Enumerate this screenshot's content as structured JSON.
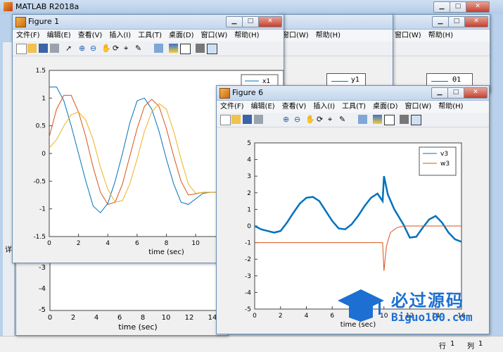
{
  "main_window": {
    "title": "MATLAB R2018a"
  },
  "statusbar": {
    "row_label": "行",
    "row_value": "1",
    "col_label": "列",
    "col_value": "1"
  },
  "left_panel": {
    "text": "详"
  },
  "menu": [
    "文件(F)",
    "编辑(E)",
    "查看(V)",
    "插入(I)",
    "工具(T)",
    "桌面(D)",
    "窗口(W)",
    "帮助(H)"
  ],
  "menu_back": [
    "窗口(W)",
    "帮助(H)"
  ],
  "figure1": {
    "title": "Figure 1",
    "xlabel": "time (sec)",
    "xticks": [
      "0",
      "2",
      "4",
      "6",
      "8",
      "10",
      "12",
      "14",
      "1"
    ],
    "yticks": [
      "1.5",
      "1",
      "0.5",
      "0",
      "-0.5",
      "-1",
      "-1.5"
    ],
    "legend": [
      "x1"
    ],
    "chart_data": {
      "type": "line",
      "xlim": [
        0,
        16
      ],
      "ylim": [
        -1.5,
        1.5
      ],
      "series": [
        {
          "name": "x1",
          "color": "#0072BD",
          "x": [
            0,
            0.5,
            1,
            1.5,
            2,
            2.5,
            3,
            3.5,
            4,
            4.5,
            5,
            5.5,
            6,
            6.5,
            7,
            7.5,
            8,
            8.5,
            9,
            9.5,
            10,
            10.5,
            11,
            12,
            14,
            16
          ],
          "y": [
            1.2,
            1.2,
            0.95,
            0.5,
            0.0,
            -0.5,
            -0.95,
            -1.07,
            -0.9,
            -0.5,
            0.0,
            0.55,
            0.95,
            1.0,
            0.8,
            0.4,
            -0.1,
            -0.55,
            -0.88,
            -0.92,
            -0.82,
            -0.72,
            -0.7,
            -0.7,
            -0.7,
            -0.7
          ]
        },
        {
          "name": "",
          "color": "#D95319",
          "x": [
            0,
            0.5,
            1,
            1.5,
            2,
            2.5,
            3,
            3.5,
            4,
            4.5,
            5,
            5.5,
            6,
            6.5,
            7,
            7.5,
            8,
            8.5,
            9,
            9.5,
            10,
            10.5,
            11,
            12,
            14,
            16
          ],
          "y": [
            0.3,
            0.8,
            1.05,
            1.05,
            0.75,
            0.3,
            -0.25,
            -0.7,
            -0.92,
            -0.88,
            -0.55,
            -0.05,
            0.45,
            0.85,
            0.98,
            0.85,
            0.45,
            -0.05,
            -0.5,
            -0.75,
            -0.73,
            -0.7,
            -0.7,
            -0.7,
            -0.7,
            -0.7
          ]
        },
        {
          "name": "",
          "color": "#EDB120",
          "x": [
            0,
            0.5,
            1,
            1.5,
            2,
            2.5,
            3,
            3.5,
            4,
            4.5,
            5,
            5.5,
            6,
            6.5,
            7,
            7.5,
            8,
            8.5,
            9,
            9.5,
            10,
            10.5,
            11,
            12,
            14,
            16
          ],
          "y": [
            0.1,
            0.25,
            0.5,
            0.7,
            0.75,
            0.6,
            0.25,
            -0.25,
            -0.65,
            -0.88,
            -0.85,
            -0.55,
            -0.1,
            0.4,
            0.75,
            0.9,
            0.8,
            0.4,
            -0.1,
            -0.55,
            -0.72,
            -0.7,
            -0.7,
            -0.7,
            -0.7,
            -0.7
          ]
        }
      ]
    }
  },
  "figure2_legend": "y1",
  "figure3_legend": "θ1",
  "figure6": {
    "title": "Figure 6",
    "xlabel": "time (sec)",
    "xticks": [
      "0",
      "2",
      "4",
      "6",
      "8",
      "10",
      "12",
      "14",
      "16"
    ],
    "yticks": [
      "5",
      "4",
      "3",
      "2",
      "1",
      "0",
      "-1",
      "-2",
      "-3",
      "-4",
      "-5"
    ],
    "legend": [
      "v3",
      "w3"
    ],
    "chart_data": {
      "type": "line",
      "xlim": [
        0,
        16
      ],
      "ylim": [
        -5,
        5
      ],
      "series": [
        {
          "name": "v3",
          "color": "#0072BD",
          "x": [
            0,
            0.5,
            1,
            1.5,
            2,
            2.5,
            3,
            3.5,
            4,
            4.5,
            5,
            5.5,
            6,
            6.5,
            7,
            7.5,
            8,
            8.5,
            9,
            9.5,
            9.9,
            10,
            10.3,
            10.8,
            11.5,
            12,
            12.5,
            13,
            13.5,
            14,
            14.5,
            15,
            15.5,
            16
          ],
          "y": [
            0,
            -0.2,
            -0.3,
            -0.4,
            -0.3,
            0.2,
            0.8,
            1.35,
            1.7,
            1.75,
            1.5,
            0.9,
            0.3,
            -0.15,
            -0.2,
            0.1,
            0.6,
            1.2,
            1.7,
            1.95,
            1.5,
            3.0,
            1.9,
            1.0,
            0.1,
            -0.7,
            -0.65,
            -0.1,
            0.4,
            0.6,
            0.2,
            -0.4,
            -0.8,
            -0.95
          ]
        },
        {
          "name": "w3",
          "color": "#D95319",
          "x": [
            0,
            2,
            4,
            6,
            8,
            9.9,
            10,
            10.2,
            10.5,
            11,
            11.5,
            12,
            13,
            14,
            16
          ],
          "y": [
            -1,
            -1,
            -1,
            -1,
            -1,
            -1,
            -2.7,
            -1.2,
            -0.4,
            -0.1,
            0,
            0,
            0,
            0,
            0
          ]
        }
      ]
    }
  },
  "figure4": {
    "yticks": [
      "-3",
      "-4",
      "-5"
    ],
    "xticks": [
      "0",
      "2",
      "4",
      "6",
      "8",
      "10",
      "12",
      "14"
    ],
    "xlabel": "time (sec)"
  },
  "watermark": {
    "title": "必过源码",
    "url": "Biguo100.com"
  }
}
